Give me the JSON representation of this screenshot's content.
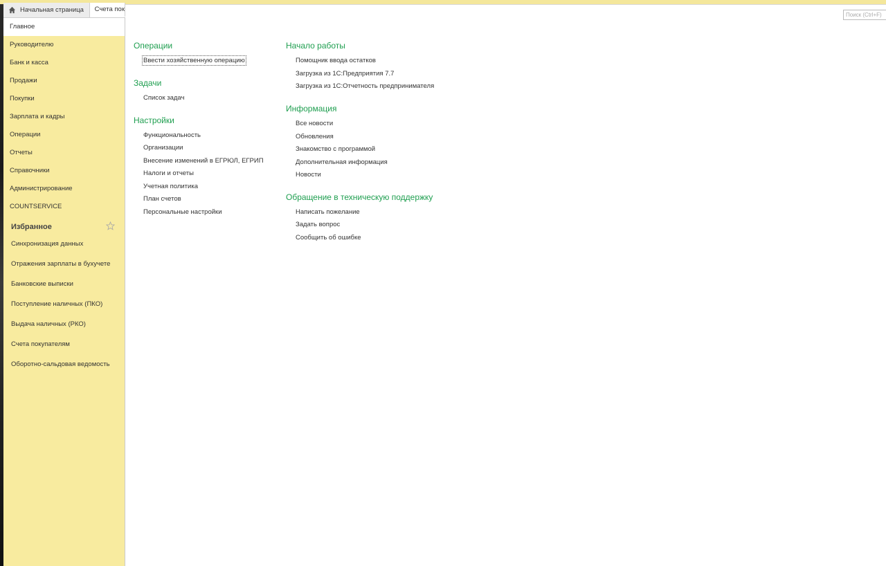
{
  "tabs": {
    "home_label": "Начальная страница",
    "second_label": "Счета пок"
  },
  "search": {
    "placeholder": "Поиск (Ctrl+F)"
  },
  "sidebar": {
    "items": [
      {
        "label": "Главное"
      },
      {
        "label": "Руководителю"
      },
      {
        "label": "Банк и касса"
      },
      {
        "label": "Продажи"
      },
      {
        "label": "Покупки"
      },
      {
        "label": "Зарплата и кадры"
      },
      {
        "label": "Операции"
      },
      {
        "label": "Отчеты"
      },
      {
        "label": "Справочники"
      },
      {
        "label": "Администрирование"
      },
      {
        "label": "COUNTSERVICE"
      }
    ],
    "favorites_title": "Избранное",
    "favorites": [
      {
        "label": "Синхронизация данных"
      },
      {
        "label": "Отражения зарплаты в бухучете"
      },
      {
        "label": "Банковские выписки"
      },
      {
        "label": "Поступление наличных (ПКО)"
      },
      {
        "label": "Выдача наличных (РКО)"
      },
      {
        "label": "Счета покупателям"
      },
      {
        "label": "Оборотно-сальдовая ведомость"
      }
    ]
  },
  "main": {
    "operations": {
      "title": "Операции",
      "links": [
        "Ввести хозяйственную операцию"
      ]
    },
    "tasks": {
      "title": "Задачи",
      "links": [
        "Список задач"
      ]
    },
    "settings": {
      "title": "Настройки",
      "links": [
        "Функциональность",
        "Организации",
        "Внесение изменений в ЕГРЮЛ, ЕГРИП",
        "Налоги и отчеты",
        "Учетная политика",
        "План счетов",
        "Персональные настройки"
      ]
    },
    "getting_started": {
      "title": "Начало работы",
      "links": [
        "Помощник ввода остатков",
        "Загрузка из 1С:Предприятия 7.7",
        "Загрузка из 1С:Отчетность предпринимателя"
      ]
    },
    "info": {
      "title": "Информация",
      "links": [
        "Все новости",
        "Обновления",
        "Знакомство с программой",
        "Дополнительная информация",
        "Новости"
      ]
    },
    "support": {
      "title": "Обращение в техническую поддержку",
      "links": [
        "Написать пожелание",
        "Задать вопрос",
        "Сообщить об ошибке"
      ]
    }
  },
  "colors": {
    "sidebar_bg": "#f8eb9f",
    "section_title": "#1e9e4f",
    "active_item_bg": "#ffffff"
  }
}
